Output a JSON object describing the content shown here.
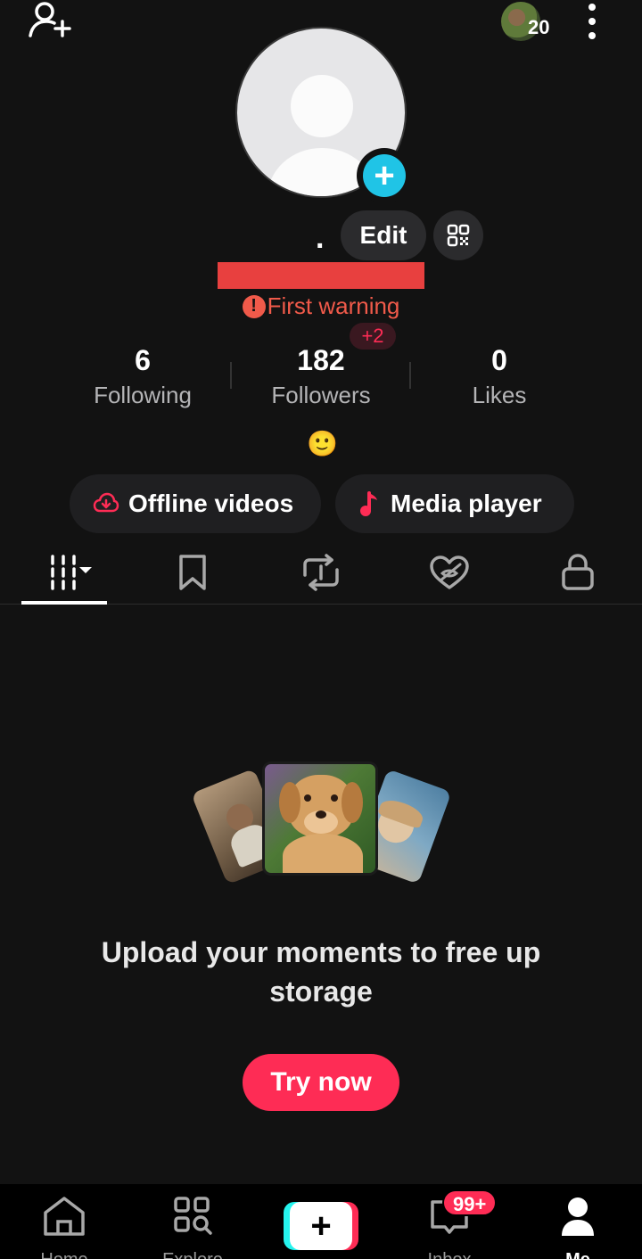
{
  "header": {
    "add_friend_icon": "person-plus-icon",
    "recent_viewers_count": "20",
    "more_icon": "vertical-dots-icon"
  },
  "profile": {
    "name_text": ".",
    "edit_label": "Edit",
    "qr_icon": "qr-code-icon",
    "avatar_add_icon": "plus-icon",
    "warning_text": "First warning",
    "warning_icon": "exclamation-icon",
    "warning_color": "#f05a4a"
  },
  "stats": [
    {
      "value": "6",
      "label": "Following"
    },
    {
      "value": "182",
      "label": "Followers"
    },
    {
      "value": "0",
      "label": "Likes"
    }
  ],
  "followers_badge": "+2",
  "bio_emoji": "🙂",
  "pills": [
    {
      "label": "Offline videos",
      "icon": "cloud-download-icon"
    },
    {
      "label": "Media player",
      "icon": "music-note-icon"
    }
  ],
  "tabs": [
    {
      "name": "videos-grid-icon",
      "active": true
    },
    {
      "name": "bookmark-icon",
      "active": false
    },
    {
      "name": "repost-icon",
      "active": false
    },
    {
      "name": "liked-hidden-icon",
      "active": false
    },
    {
      "name": "lock-icon",
      "active": false
    }
  ],
  "empty_state": {
    "title": "Upload your moments to free up storage",
    "button_label": "Try now"
  },
  "bottom_nav": {
    "items": [
      {
        "label": "Home",
        "icon": "home-icon"
      },
      {
        "label": "Explore",
        "icon": "explore-icon"
      },
      {
        "label": "",
        "icon": "create-plus-icon"
      },
      {
        "label": "Inbox",
        "icon": "inbox-icon"
      },
      {
        "label": "Me",
        "icon": "profile-icon"
      }
    ],
    "inbox_badge": "99+"
  },
  "colors": {
    "accent": "#fe2c55",
    "cyan": "#25f4ee",
    "avatar_plus": "#20c4e6",
    "background": "#121212"
  }
}
